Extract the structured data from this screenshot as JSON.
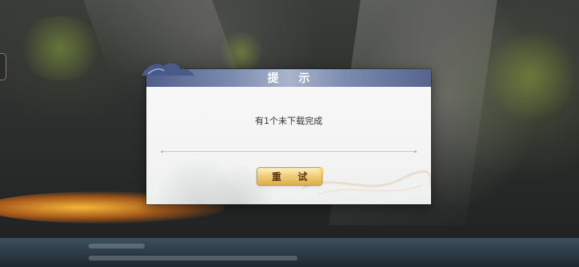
{
  "dialog": {
    "title": "提 示",
    "message": "有1个未下载完成",
    "retry_label": "重 试"
  },
  "icons": {
    "title_ornament": "cloud-wave-icon",
    "button_ornament": "sparkle-icon",
    "edge_tab": "side-tab-icon"
  },
  "colors": {
    "title_bar": "#7b8bb0",
    "button_gold": "#f0cf7a",
    "dialog_bg": "#f5f6f5"
  }
}
